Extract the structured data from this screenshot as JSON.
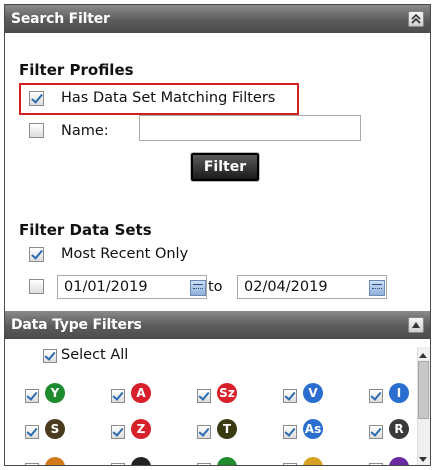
{
  "search_filter": {
    "header_title": "Search Filter",
    "filter_profiles_title": "Filter Profiles",
    "has_data_set_label": "Has Data Set Matching Filters",
    "has_data_set_checked": true,
    "name_label": "Name:",
    "name_checked": false,
    "name_value": "",
    "filter_button_label": "Filter",
    "filter_data_sets_title": "Filter Data Sets",
    "most_recent_label": "Most Recent Only",
    "most_recent_checked": true,
    "date_range_checked": false,
    "date_from": "01/01/2019",
    "to_label": "to",
    "date_to": "02/04/2019"
  },
  "data_type_filters": {
    "header_title": "Data Type Filters",
    "select_all_label": "Select All",
    "select_all_checked": true,
    "badges": [
      {
        "letter": "Y",
        "color": "#1e8c2e"
      },
      {
        "letter": "A",
        "color": "#d8202a"
      },
      {
        "letter": "Sz",
        "color": "#d8202a"
      },
      {
        "letter": "V",
        "color": "#2a6fd0"
      },
      {
        "letter": "I",
        "color": "#2a6fd0"
      },
      {
        "letter": "S",
        "color": "#4a3a1e"
      },
      {
        "letter": "Z",
        "color": "#d8202a"
      },
      {
        "letter": "T",
        "color": "#3a3a10"
      },
      {
        "letter": "As",
        "color": "#2a6fd0"
      },
      {
        "letter": "R",
        "color": "#3a3a3a"
      }
    ]
  },
  "colors": {
    "highlight": "#d11f1f",
    "header_bg": "#5b5b5b",
    "check": "#2b6bb2"
  }
}
